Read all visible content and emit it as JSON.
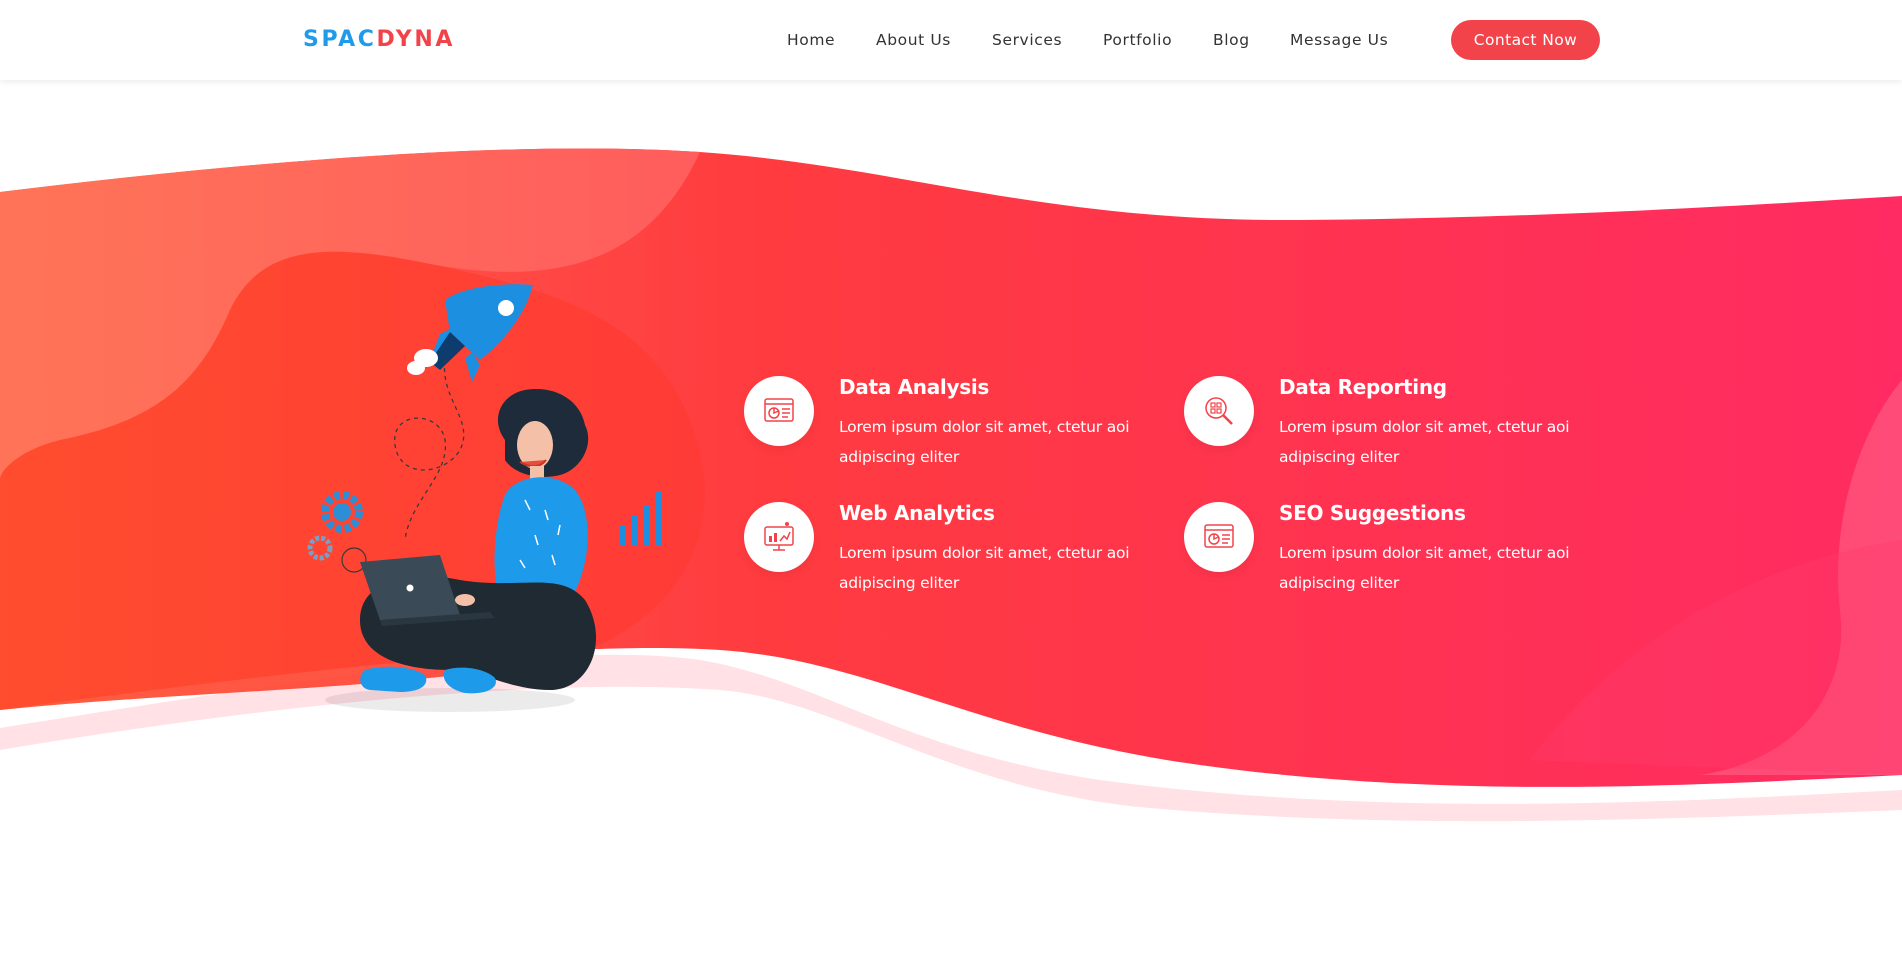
{
  "brand": {
    "part1": "SPAC",
    "part2": "DYNA",
    "color1": "#1e9bea",
    "color2": "#f2434a"
  },
  "nav": {
    "items": [
      {
        "label": "Home"
      },
      {
        "label": "About Us"
      },
      {
        "label": "Services"
      },
      {
        "label": "Portfolio"
      },
      {
        "label": "Blog"
      },
      {
        "label": "Message Us"
      }
    ],
    "cta_label": "Contact Now"
  },
  "hero": {
    "illustration_icon": "woman-with-laptop-and-rocket",
    "colors": {
      "wave_start": "#ff4a2b",
      "wave_end": "#ff2d63",
      "light_wave": "#ffe3e8"
    }
  },
  "features": [
    {
      "title": "Data Analysis",
      "description": "Lorem ipsum dolor sit amet, ctetur aoi adipiscing eliter",
      "icon": "chart-document-icon"
    },
    {
      "title": "Data Reporting",
      "description": "Lorem ipsum dolor sit amet, ctetur aoi adipiscing eliter",
      "icon": "magnifier-chart-icon"
    },
    {
      "title": "Web Analytics",
      "description": "Lorem ipsum dolor sit amet, ctetur aoi adipiscing eliter",
      "icon": "monitor-analytics-icon"
    },
    {
      "title": "SEO Suggestions",
      "description": "Lorem ipsum dolor sit amet, ctetur aoi adipiscing eliter",
      "icon": "chart-document-icon"
    }
  ]
}
